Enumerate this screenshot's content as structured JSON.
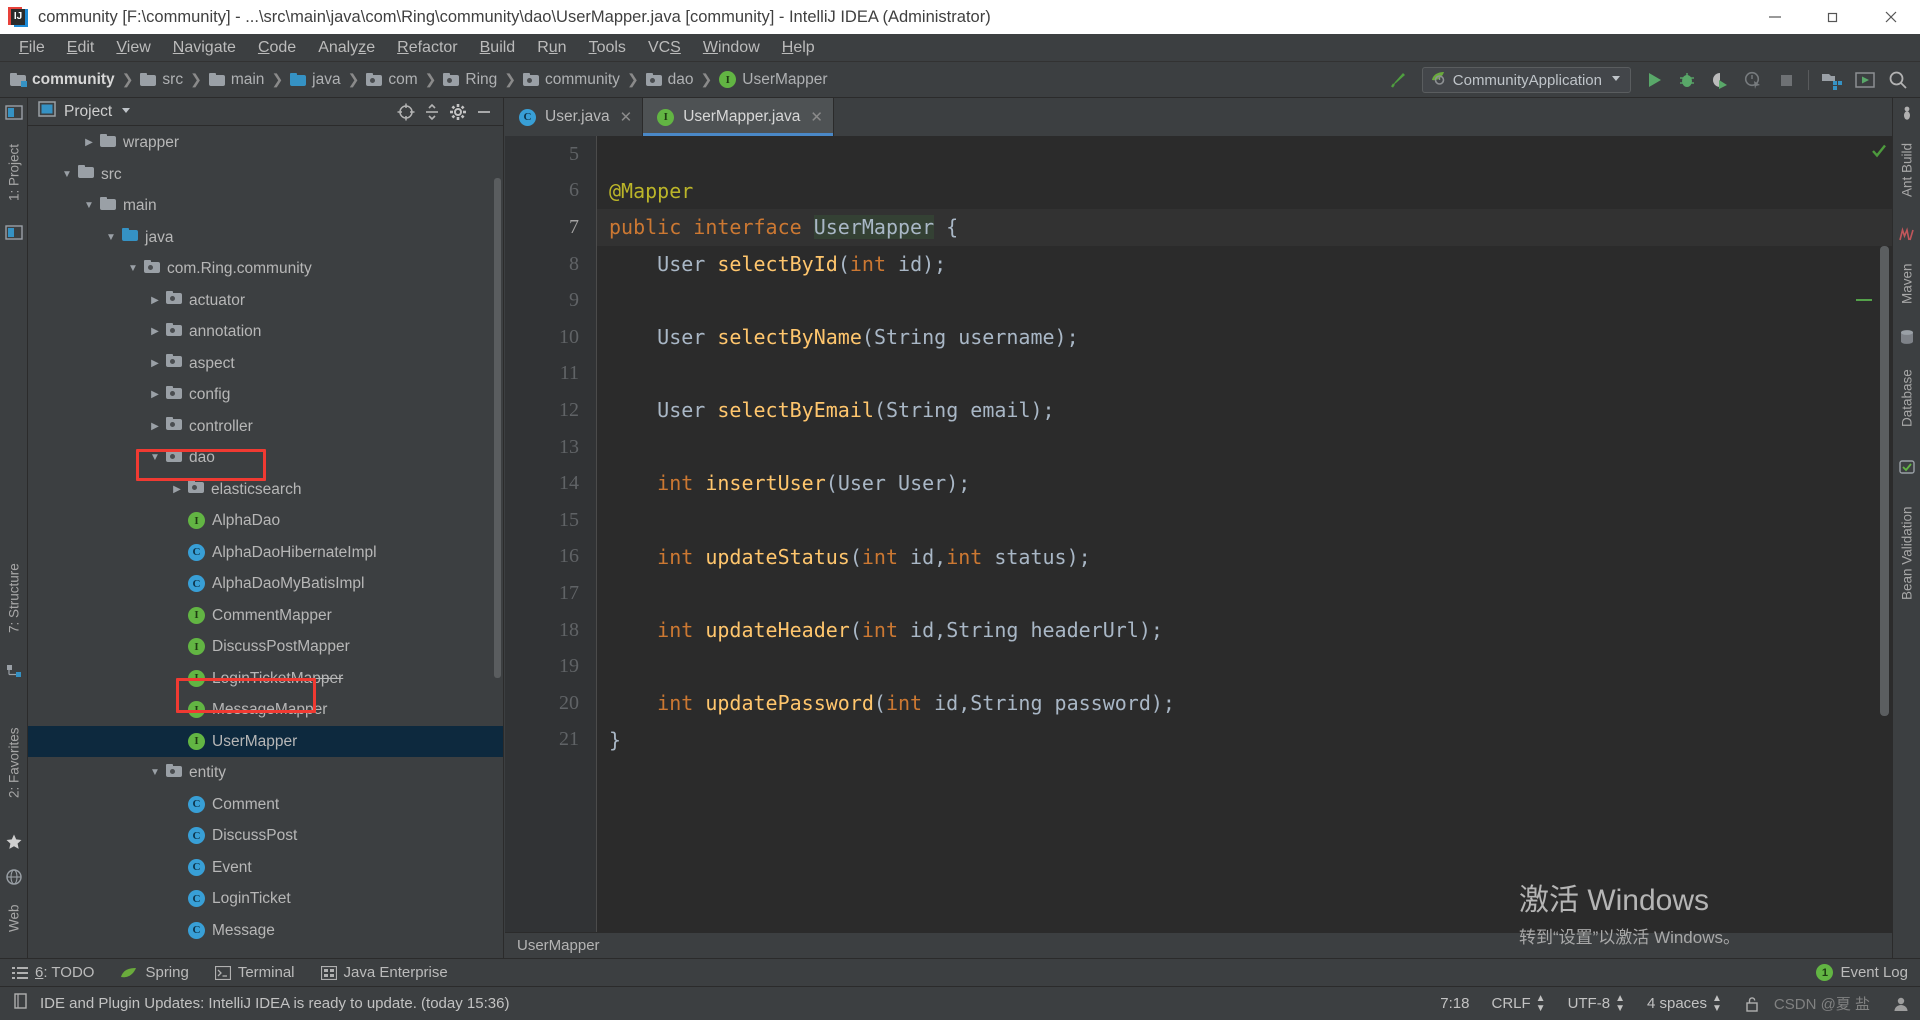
{
  "window": {
    "title": "community [F:\\community] - ...\\src\\main\\java\\com\\Ring\\community\\dao\\UserMapper.java [community] - IntelliJ IDEA (Administrator)",
    "app_icon": "intellij-idea-icon",
    "minimize": "minimize-icon",
    "maximize": "restore-icon",
    "close": "close-icon"
  },
  "menubar": {
    "items": [
      {
        "mnemonic": "F",
        "rest": "ile"
      },
      {
        "mnemonic": "E",
        "rest": "dit"
      },
      {
        "mnemonic": "V",
        "rest": "iew"
      },
      {
        "mnemonic": "N",
        "rest": "avigate"
      },
      {
        "mnemonic": "C",
        "rest": "ode"
      },
      {
        "mnemonic": "A",
        "rest": "nalyze",
        "mid": true
      },
      {
        "mnemonic": "R",
        "rest": "efactor"
      },
      {
        "mnemonic": "B",
        "rest": "uild"
      },
      {
        "mnemonic": "R",
        "rest": "un",
        "mid": true
      },
      {
        "mnemonic": "T",
        "rest": "ools"
      },
      {
        "mnemonic": "VCS",
        "rest": ""
      },
      {
        "mnemonic": "W",
        "rest": "indow"
      },
      {
        "mnemonic": "H",
        "rest": "elp"
      }
    ],
    "labels": [
      "File",
      "Edit",
      "View",
      "Navigate",
      "Code",
      "Analyze",
      "Refactor",
      "Build",
      "Run",
      "Tools",
      "VCS",
      "Window",
      "Help"
    ]
  },
  "breadcrumb": {
    "separator": "❯",
    "items": [
      {
        "label": "community",
        "icon": "module-folder-icon",
        "bold": true
      },
      {
        "label": "src",
        "icon": "folder-icon",
        "bold": false
      },
      {
        "label": "main",
        "icon": "folder-icon",
        "bold": false
      },
      {
        "label": "java",
        "icon": "source-folder-icon",
        "bold": false
      },
      {
        "label": "com",
        "icon": "package-folder-icon",
        "bold": false
      },
      {
        "label": "Ring",
        "icon": "package-folder-icon",
        "bold": false
      },
      {
        "label": "community",
        "icon": "package-folder-icon",
        "bold": false
      },
      {
        "label": "dao",
        "icon": "package-folder-icon",
        "bold": false
      },
      {
        "label": "UserMapper",
        "icon": "interface-icon",
        "bold": false
      }
    ]
  },
  "toolbar": {
    "build_icon": "hammer-build-icon",
    "run_configuration": "CommunityApplication",
    "run_config_icon": "spring-boot-icon",
    "dropdown_icon": "chevron-down-icon",
    "buttons": [
      {
        "name": "run-button",
        "icon": "play-icon"
      },
      {
        "name": "debug-button",
        "icon": "bug-icon"
      },
      {
        "name": "run-with-coverage-button",
        "icon": "coverage-icon"
      },
      {
        "name": "profiler-button",
        "icon": "profiler-icon"
      },
      {
        "name": "stop-button",
        "icon": "stop-icon"
      },
      {
        "name": "open-project-structure-button",
        "icon": "project-structure-icon"
      },
      {
        "name": "update-running-application-button",
        "icon": "update-app-icon"
      },
      {
        "name": "search-everywhere-button",
        "icon": "search-icon"
      }
    ]
  },
  "left_strip": {
    "items": [
      {
        "label": "1: Project",
        "icon": "project-tool-icon"
      },
      {
        "label": "7: Structure",
        "icon": "structure-tool-icon"
      },
      {
        "label": "2: Favorites",
        "icon": "favorites-star-icon"
      },
      {
        "label": "Web",
        "icon": "web-tool-icon"
      }
    ]
  },
  "right_strip": {
    "items": [
      {
        "label": "Ant Build",
        "icon": "ant-icon"
      },
      {
        "label": "Maven",
        "icon": "maven-icon"
      },
      {
        "label": "Database",
        "icon": "database-icon"
      },
      {
        "label": "Bean Validation",
        "icon": "bean-validation-icon"
      }
    ]
  },
  "project_panel": {
    "title": "Project",
    "title_icon": "project-window-icon",
    "dropdown_icon": "chevron-down-icon",
    "actions": [
      {
        "name": "scroll-from-source-button",
        "icon": "target-crosshair-icon"
      },
      {
        "name": "collapse-all-button",
        "icon": "collapse-all-icon"
      },
      {
        "name": "settings-button",
        "icon": "gear-icon"
      },
      {
        "name": "hide-button",
        "icon": "minimize-icon"
      }
    ],
    "tree": [
      {
        "label": "wrapper",
        "indent": 2,
        "twisty": "collapsed",
        "icon": "folder-icon",
        "selected": false,
        "struck": false
      },
      {
        "label": "src",
        "indent": 1,
        "twisty": "expanded",
        "icon": "folder-icon",
        "selected": false,
        "struck": false
      },
      {
        "label": "main",
        "indent": 2,
        "twisty": "expanded",
        "icon": "folder-icon",
        "selected": false,
        "struck": false
      },
      {
        "label": "java",
        "indent": 3,
        "twisty": "expanded",
        "icon": "source-folder-icon",
        "selected": false,
        "struck": false
      },
      {
        "label": "com.Ring.community",
        "indent": 4,
        "twisty": "expanded",
        "icon": "package-folder-icon",
        "selected": false,
        "struck": false
      },
      {
        "label": "actuator",
        "indent": 5,
        "twisty": "collapsed",
        "icon": "package-folder-icon",
        "selected": false,
        "struck": false
      },
      {
        "label": "annotation",
        "indent": 5,
        "twisty": "collapsed",
        "icon": "package-folder-icon",
        "selected": false,
        "struck": false
      },
      {
        "label": "aspect",
        "indent": 5,
        "twisty": "collapsed",
        "icon": "package-folder-icon",
        "selected": false,
        "struck": false
      },
      {
        "label": "config",
        "indent": 5,
        "twisty": "collapsed",
        "icon": "package-folder-icon",
        "selected": false,
        "struck": false
      },
      {
        "label": "controller",
        "indent": 5,
        "twisty": "collapsed",
        "icon": "package-folder-icon",
        "selected": false,
        "struck": false
      },
      {
        "label": "dao",
        "indent": 5,
        "twisty": "expanded",
        "icon": "package-folder-icon",
        "selected": false,
        "struck": false
      },
      {
        "label": "elasticsearch",
        "indent": 6,
        "twisty": "collapsed",
        "icon": "package-folder-icon",
        "selected": false,
        "struck": false
      },
      {
        "label": "AlphaDao",
        "indent": 6,
        "twisty": "none",
        "icon": "interface-icon",
        "selected": false,
        "struck": false
      },
      {
        "label": "AlphaDaoHibernateImpl",
        "indent": 6,
        "twisty": "none",
        "icon": "class-icon",
        "selected": false,
        "struck": false
      },
      {
        "label": "AlphaDaoMyBatisImpl",
        "indent": 6,
        "twisty": "none",
        "icon": "class-icon",
        "selected": false,
        "struck": false
      },
      {
        "label": "CommentMapper",
        "indent": 6,
        "twisty": "none",
        "icon": "interface-icon",
        "selected": false,
        "struck": false
      },
      {
        "label": "DiscussPostMapper",
        "indent": 6,
        "twisty": "none",
        "icon": "interface-icon",
        "selected": false,
        "struck": false
      },
      {
        "label": "LoginTicketMapper",
        "indent": 6,
        "twisty": "none",
        "icon": "interface-icon",
        "selected": false,
        "struck": true
      },
      {
        "label": "MessageMapper",
        "indent": 6,
        "twisty": "none",
        "icon": "interface-icon",
        "selected": false,
        "struck": false
      },
      {
        "label": "UserMapper",
        "indent": 6,
        "twisty": "none",
        "icon": "interface-icon",
        "selected": true,
        "struck": false
      },
      {
        "label": "entity",
        "indent": 5,
        "twisty": "expanded",
        "icon": "package-folder-icon",
        "selected": false,
        "struck": false
      },
      {
        "label": "Comment",
        "indent": 6,
        "twisty": "none",
        "icon": "class-icon",
        "selected": false,
        "struck": false
      },
      {
        "label": "DiscussPost",
        "indent": 6,
        "twisty": "none",
        "icon": "class-icon",
        "selected": false,
        "struck": false
      },
      {
        "label": "Event",
        "indent": 6,
        "twisty": "none",
        "icon": "class-icon",
        "selected": false,
        "struck": false
      },
      {
        "label": "LoginTicket",
        "indent": 6,
        "twisty": "none",
        "icon": "class-icon",
        "selected": false,
        "struck": false
      },
      {
        "label": "Message",
        "indent": 6,
        "twisty": "none",
        "icon": "class-icon",
        "selected": false,
        "struck": false
      }
    ],
    "highlights": [
      {
        "name": "dao-highlight-box",
        "color": "#f03a32"
      },
      {
        "name": "usermapper-highlight-box",
        "color": "#f03a32"
      }
    ]
  },
  "editor": {
    "tabs": [
      {
        "label": "User.java",
        "icon": "class-icon",
        "active": false,
        "close_icon": "close-icon"
      },
      {
        "label": "UserMapper.java",
        "icon": "interface-icon",
        "active": true,
        "close_icon": "close-icon"
      }
    ],
    "breadcrumb_bar": "UserMapper",
    "inspection_status_icon": "inspections-ok-icon",
    "first_line_number": 5,
    "current_line": 7,
    "lines": [
      {
        "n": 5,
        "tokens": []
      },
      {
        "n": 6,
        "tokens": [
          {
            "t": "@Mapper",
            "c": "ann"
          }
        ]
      },
      {
        "n": 7,
        "tokens": [
          {
            "t": "public",
            "c": "kw"
          },
          {
            "t": " ",
            "c": "pun"
          },
          {
            "t": "interface",
            "c": "kw"
          },
          {
            "t": " ",
            "c": "pun"
          },
          {
            "t": "UserMapper",
            "c": "hl"
          },
          {
            "t": " {",
            "c": "pun"
          }
        ]
      },
      {
        "n": 8,
        "tokens": [
          {
            "t": "    ",
            "c": "pun"
          },
          {
            "t": "User",
            "c": "typ"
          },
          {
            "t": " ",
            "c": "pun"
          },
          {
            "t": "selectById",
            "c": "mth"
          },
          {
            "t": "(",
            "c": "pun"
          },
          {
            "t": "int",
            "c": "kw"
          },
          {
            "t": " id);",
            "c": "pun"
          }
        ]
      },
      {
        "n": 9,
        "tokens": []
      },
      {
        "n": 10,
        "tokens": [
          {
            "t": "    ",
            "c": "pun"
          },
          {
            "t": "User",
            "c": "typ"
          },
          {
            "t": " ",
            "c": "pun"
          },
          {
            "t": "selectByName",
            "c": "mth"
          },
          {
            "t": "(",
            "c": "pun"
          },
          {
            "t": "String",
            "c": "typ"
          },
          {
            "t": " username);",
            "c": "pun"
          }
        ]
      },
      {
        "n": 11,
        "tokens": []
      },
      {
        "n": 12,
        "tokens": [
          {
            "t": "    ",
            "c": "pun"
          },
          {
            "t": "User",
            "c": "typ"
          },
          {
            "t": " ",
            "c": "pun"
          },
          {
            "t": "selectByEmail",
            "c": "mth"
          },
          {
            "t": "(",
            "c": "pun"
          },
          {
            "t": "String",
            "c": "typ"
          },
          {
            "t": " email);",
            "c": "pun"
          }
        ]
      },
      {
        "n": 13,
        "tokens": []
      },
      {
        "n": 14,
        "tokens": [
          {
            "t": "    ",
            "c": "pun"
          },
          {
            "t": "int",
            "c": "kw"
          },
          {
            "t": " ",
            "c": "pun"
          },
          {
            "t": "insertUser",
            "c": "mth"
          },
          {
            "t": "(",
            "c": "pun"
          },
          {
            "t": "User",
            "c": "typ"
          },
          {
            "t": " User);",
            "c": "pun"
          }
        ]
      },
      {
        "n": 15,
        "tokens": []
      },
      {
        "n": 16,
        "tokens": [
          {
            "t": "    ",
            "c": "pun"
          },
          {
            "t": "int",
            "c": "kw"
          },
          {
            "t": " ",
            "c": "pun"
          },
          {
            "t": "updateStatus",
            "c": "mth"
          },
          {
            "t": "(",
            "c": "pun"
          },
          {
            "t": "int",
            "c": "kw"
          },
          {
            "t": " id,",
            "c": "pun"
          },
          {
            "t": "int",
            "c": "kw"
          },
          {
            "t": " status);",
            "c": "pun"
          }
        ]
      },
      {
        "n": 17,
        "tokens": []
      },
      {
        "n": 18,
        "tokens": [
          {
            "t": "    ",
            "c": "pun"
          },
          {
            "t": "int",
            "c": "kw"
          },
          {
            "t": " ",
            "c": "pun"
          },
          {
            "t": "updateHeader",
            "c": "mth"
          },
          {
            "t": "(",
            "c": "pun"
          },
          {
            "t": "int",
            "c": "kw"
          },
          {
            "t": " id,",
            "c": "pun"
          },
          {
            "t": "String",
            "c": "typ"
          },
          {
            "t": " headerUrl);",
            "c": "pun"
          }
        ]
      },
      {
        "n": 19,
        "tokens": []
      },
      {
        "n": 20,
        "tokens": [
          {
            "t": "    ",
            "c": "pun"
          },
          {
            "t": "int",
            "c": "kw"
          },
          {
            "t": " ",
            "c": "pun"
          },
          {
            "t": "updatePassword",
            "c": "mth"
          },
          {
            "t": "(",
            "c": "pun"
          },
          {
            "t": "int",
            "c": "kw"
          },
          {
            "t": " id,",
            "c": "pun"
          },
          {
            "t": "String",
            "c": "typ"
          },
          {
            "t": " password);",
            "c": "pun"
          }
        ]
      },
      {
        "n": 21,
        "tokens": [
          {
            "t": "}",
            "c": "pun"
          }
        ]
      }
    ]
  },
  "tool_windows_bar": {
    "items": [
      {
        "label": "6: TODO",
        "mnemonic": "6",
        "rest": ": TODO",
        "icon": "todo-list-icon"
      },
      {
        "label": "Spring",
        "mnemonic": "",
        "rest": "Spring",
        "icon": "spring-leaf-icon"
      },
      {
        "label": "Terminal",
        "mnemonic": "",
        "rest": "Terminal",
        "icon": "terminal-icon"
      },
      {
        "label": "Java Enterprise",
        "mnemonic": "",
        "rest": "Java Enterprise",
        "icon": "java-enterprise-icon"
      }
    ],
    "event_log": {
      "label": "Event Log",
      "badge": "1",
      "icon": "event-log-icon"
    }
  },
  "statusbar": {
    "icon": "status-message-icon",
    "message": "IDE and Plugin Updates: IntelliJ IDEA is ready to update. (today 15:36)",
    "caret_position": "7:18",
    "line_separator": "CRLF",
    "encoding": "UTF-8",
    "indent": "4 spaces",
    "watermark_text": "CSDN @夏 盐",
    "lock_icon": "unlocked-icon",
    "face_icon": "user-face-icon"
  },
  "watermark": {
    "line1": "激活 Windows",
    "line2": "转到“设置”以激活 Windows。"
  },
  "colors": {
    "window_bg": "#3c3f41",
    "editor_bg": "#2b2b2b",
    "gutter_bg": "#313335",
    "selection_blue": "#0d293e",
    "accent_green": "#62b543",
    "accent_blue": "#389fd6",
    "highlight_red": "#f03a32",
    "keyword_orange": "#cc7832",
    "method_yellow": "#ffc66d",
    "annotation_yellow": "#bbb529",
    "identifier_grey": "#a9b7c6"
  }
}
